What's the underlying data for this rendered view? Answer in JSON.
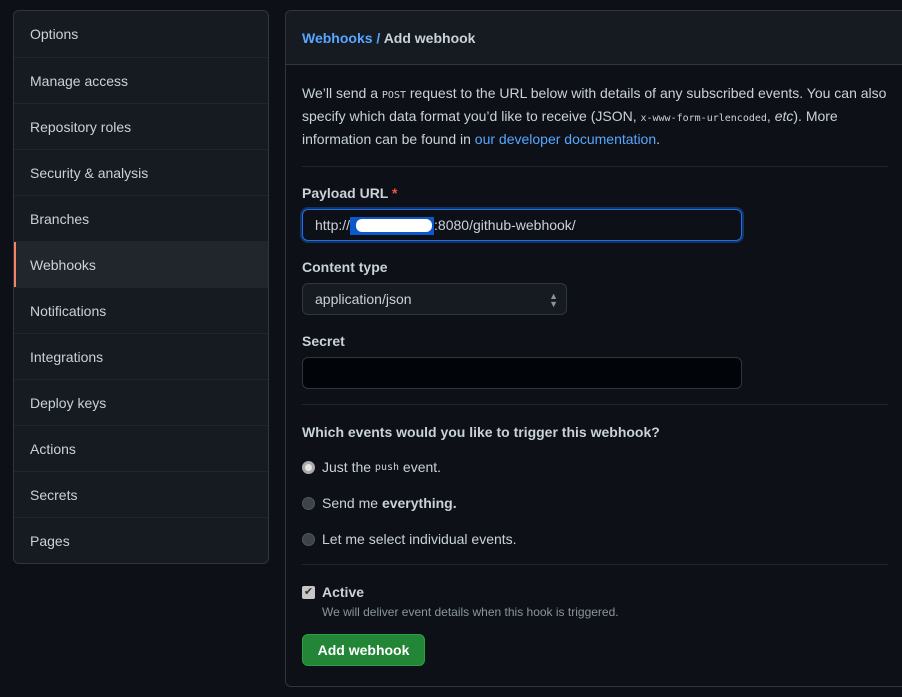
{
  "sidebar": {
    "items": [
      {
        "label": "Options"
      },
      {
        "label": "Manage access"
      },
      {
        "label": "Repository roles"
      },
      {
        "label": "Security & analysis"
      },
      {
        "label": "Branches"
      },
      {
        "label": "Webhooks",
        "selected": true
      },
      {
        "label": "Notifications"
      },
      {
        "label": "Integrations"
      },
      {
        "label": "Deploy keys"
      },
      {
        "label": "Actions"
      },
      {
        "label": "Secrets"
      },
      {
        "label": "Pages"
      }
    ]
  },
  "header": {
    "breadcrumb_link": "Webhooks",
    "separator": " / ",
    "title": "Add webhook"
  },
  "intro": {
    "t1": "We’ll send a ",
    "code1": "POST",
    "t2": " request to the URL below with details of any subscribed events. You can also specify which data format you’d like to receive (JSON, ",
    "code2": "x-www-form-urlencoded",
    "t3": ", ",
    "em": "etc",
    "t4": "). More information can be found in ",
    "link": "our developer documentation",
    "t5": "."
  },
  "payload": {
    "label": "Payload URL",
    "required": "*",
    "value_prefix": "http://",
    "value_suffix": ":8080/github-webhook/"
  },
  "content_type": {
    "label": "Content type",
    "value": "application/json"
  },
  "secret": {
    "label": "Secret",
    "value": ""
  },
  "events": {
    "question": "Which events would you like to trigger this webhook?",
    "options": [
      {
        "pre": "Just the ",
        "code": "push",
        "post": " event.",
        "selected": true
      },
      {
        "pre": "Send me ",
        "bold": "everything."
      },
      {
        "pre": "Let me select individual events."
      }
    ]
  },
  "active": {
    "label": "Active",
    "checked": true,
    "note": "We will deliver event details when this hook is triggered."
  },
  "submit": {
    "label": "Add webhook"
  },
  "colors": {
    "bg": "#0d1117",
    "accent": "#58a6ff",
    "button": "#238636",
    "selected_marker": "#f78166"
  }
}
